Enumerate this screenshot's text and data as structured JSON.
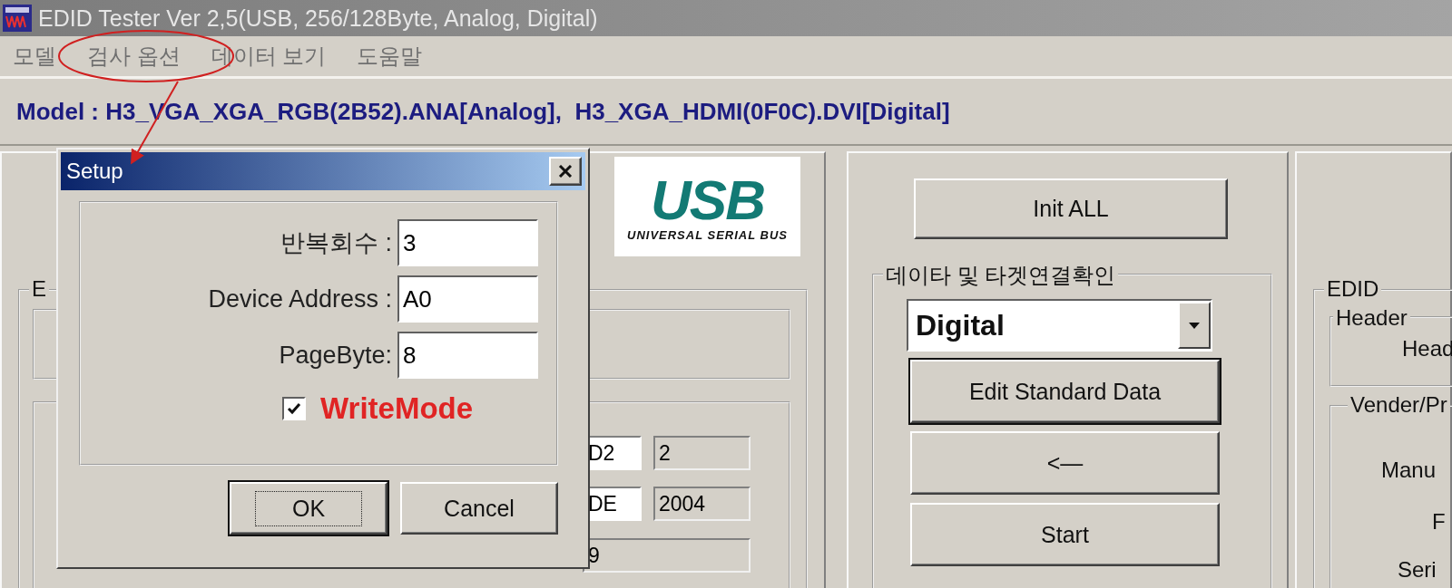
{
  "window": {
    "title": "EDID Tester Ver 2,5(USB, 256/128Byte, Analog, Digital)"
  },
  "menu": [
    {
      "label": "모델"
    },
    {
      "label": "검사 옵션"
    },
    {
      "label": "데이터 보기"
    },
    {
      "label": "도움말"
    }
  ],
  "model_line": "Model : H3_VGA_XGA_RGB(2B52).ANA[Analog],  H3_XGA_HDMI(0F0C).DVI[Digital]",
  "logo": {
    "text": "USB",
    "caption": "UNIVERSAL SERIAL BUS"
  },
  "left_panel": {
    "group_label": "E",
    "fields": [
      {
        "value": "D2",
        "readonly": false
      },
      {
        "value": "2",
        "readonly": true
      },
      {
        "value": "DE",
        "readonly": false
      },
      {
        "value": "2004",
        "readonly": true
      },
      {
        "value": "9",
        "readonly": true
      }
    ]
  },
  "middle_panel": {
    "init_button": "Init ALL",
    "group_label": "데이타 및 타겟연결확인",
    "combo": {
      "value": "Digital"
    },
    "buttons": [
      {
        "label": "Edit Standard Data",
        "default": true
      },
      {
        "label": "<—",
        "default": false
      },
      {
        "label": "Start",
        "default": false
      }
    ]
  },
  "right_panel": {
    "group_label": "EDID",
    "header_group": "Header",
    "header_text": "Head",
    "vendor_group": "Vender/Pr",
    "labels": [
      "Manu",
      "F",
      "Seri"
    ]
  },
  "dialog": {
    "title": "Setup",
    "fields": [
      {
        "label": "반복회수 :",
        "value": "3"
      },
      {
        "label": "Device Address :",
        "value": "A0"
      },
      {
        "label": "PageByte:",
        "value": "8"
      }
    ],
    "checkbox": {
      "label": "WriteMode",
      "checked": true
    },
    "buttons": [
      {
        "label": "OK",
        "default": true
      },
      {
        "label": "Cancel",
        "default": false
      }
    ]
  }
}
